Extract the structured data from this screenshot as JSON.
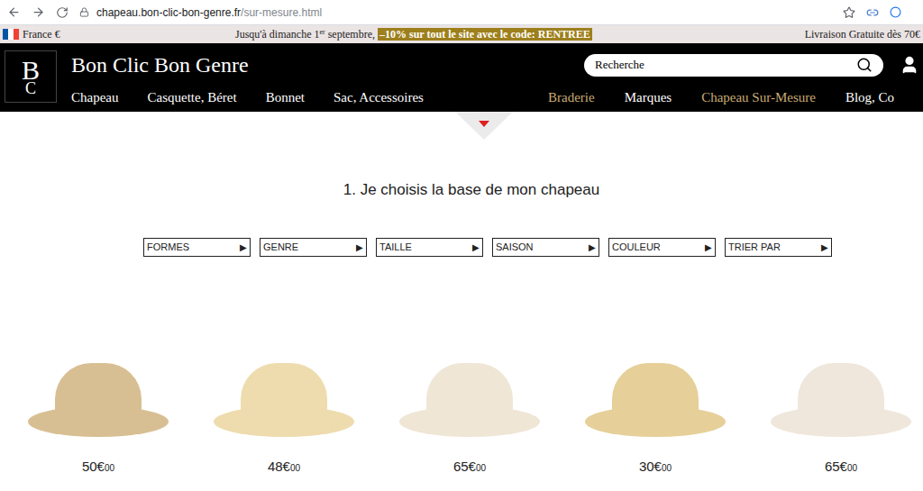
{
  "browser": {
    "url_domain": "chapeau.bon-clic-bon-genre.fr",
    "url_path": "/sur-mesure.html"
  },
  "promo": {
    "country": "France €",
    "message_start": "Jusqu'à dimanche 1",
    "message_sup": "er",
    "message_mid": " septembre, ",
    "highlight": "–10% sur tout le site avec le code: RENTREE",
    "shipping": "Livraison Gratuite dès 70€"
  },
  "header": {
    "logo_letters": [
      "B",
      "C"
    ],
    "brand": "Bon Clic Bon Genre",
    "search": {
      "placeholder": "Recherche"
    },
    "nav_left": [
      {
        "label": "Chapeau",
        "color": "#ffffff"
      },
      {
        "label": "Casquette, Béret",
        "color": "#ffffff"
      },
      {
        "label": "Bonnet",
        "color": "#ffffff"
      },
      {
        "label": "Sac, Accessoires",
        "color": "#ffffff"
      }
    ],
    "nav_right": [
      {
        "label": "Braderie",
        "color": "#c9ab73"
      },
      {
        "label": "Marques",
        "color": "#ffffff"
      },
      {
        "label": "Chapeau Sur-Mesure",
        "color": "#c9ab73"
      },
      {
        "label": "Blog, Co",
        "color": "#ffffff"
      }
    ]
  },
  "step": {
    "title": "1. Je choisis la base de mon chapeau"
  },
  "filters": [
    {
      "label": "FORMES",
      "arrow": "▶"
    },
    {
      "label": "GENRE",
      "arrow": "▶"
    },
    {
      "label": "TAILLE",
      "arrow": "▶"
    },
    {
      "label": "SAISON",
      "arrow": "▶"
    },
    {
      "label": "COULEUR",
      "arrow": "▶"
    },
    {
      "label": "TRIER PAR",
      "arrow": "▶"
    }
  ],
  "products": [
    {
      "price": "50€",
      "cents": "00",
      "color": "#d8bf93"
    },
    {
      "price": "48€",
      "cents": "00",
      "color": "#eedcae"
    },
    {
      "price": "65€",
      "cents": "00",
      "color": "#efe6d6"
    },
    {
      "price": "30€",
      "cents": "00",
      "color": "#e6cf98"
    },
    {
      "price": "65€",
      "cents": "00",
      "color": "#efe7dc"
    }
  ]
}
